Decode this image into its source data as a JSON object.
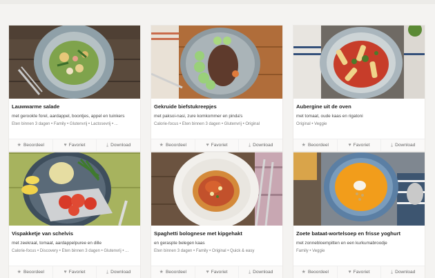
{
  "actions": {
    "rate": "Beoordeel",
    "favorite": "Favoriet",
    "download": "Download"
  },
  "icons": {
    "rate": "star-icon",
    "favorite": "heart-icon",
    "download": "download-icon"
  },
  "recipes": [
    {
      "title": "Lauwwarme salade",
      "subtitle": "met gerookte forel, aardappel, boontjes, appel en tuinkers",
      "tags": "Eten binnen 3 dagen  •  Family  •  Glutenvrij  •  Lactosevrij  •  ..."
    },
    {
      "title": "Gekruide biefstukreepjes",
      "subtitle": "met paksoi-nasi, zure komkommer en pinda's",
      "tags": "Calorie-focus  •  Eten binnen 3 dagen  •  Glutenvrij  •  Original"
    },
    {
      "title": "Aubergine uit de oven",
      "subtitle": "met tomaat, oude kaas en rigatoni",
      "tags": "Original  •  Veggie"
    },
    {
      "title": "Vispakketje van schelvis",
      "subtitle": "met zeekraal, tomaat, aardappelpuree en dille",
      "tags": "Calorie-focus  •  Discovery  •  Eten binnen 3 dagen  •  Glutenvrij  •  ..."
    },
    {
      "title": "Spaghetti bolognese met kipgehakt",
      "subtitle": "en geraspte belegen kaas",
      "tags": "Eten binnen 3 dagen  •  Family  •  Original  •  Quick & easy"
    },
    {
      "title": "Zoete bataat-wortelsoep en frisse yoghurt",
      "subtitle": "met zonnebloempitten en een kurkumabroodje",
      "tags": "Family  •  Veggie"
    }
  ]
}
